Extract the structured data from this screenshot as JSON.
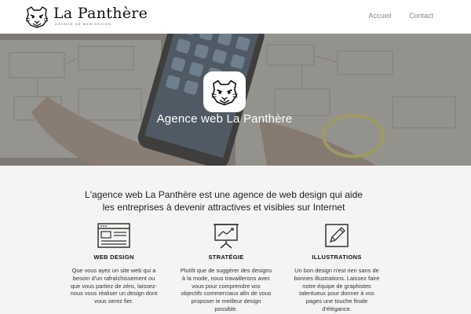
{
  "brand": {
    "name": "La Panthère",
    "tagline": "AGENCE DE WEB DESIGN",
    "logo_icon": "panther-head-icon"
  },
  "nav": {
    "items": [
      {
        "label": "Accueil"
      },
      {
        "label": "Contact"
      }
    ]
  },
  "hero": {
    "title": "Agence web La Panthère",
    "badge_icon": "panther-head-icon"
  },
  "intro": {
    "line1": "L'agence web La Panthère est une agence de web design qui aide",
    "line2": "les entreprises à devenir attractives et visibles sur Internet"
  },
  "features": [
    {
      "icon": "browser-window-icon",
      "title": "WEB DESIGN",
      "lines": [
        "Que vous ayez un site web qui a",
        "besoin d'un rafraîchissement ou",
        "que vous partiez de zéro, laissez-",
        "nous vous réaliser un design dont",
        "vous serez fier."
      ]
    },
    {
      "icon": "presentation-chart-icon",
      "title": "STRATÉGIE",
      "lines": [
        "Plutôt que de suggérer des designs",
        "à la mode, nous travaillerons avec",
        "vous pour comprendre vos",
        "objectifs commerciaux afin de vous",
        "proposer le meilleur design",
        "possible."
      ]
    },
    {
      "icon": "pencil-edit-icon",
      "title": "ILLUSTRATIONS",
      "lines": [
        "Un bon design n'est rien sans de",
        "bonnes illustrations. Laissez faire",
        "notre équipe de graphistes",
        "talentueux pour donner à vos",
        "pages une touche finale",
        "d'élégance."
      ]
    }
  ],
  "colors": {
    "header_bg": "#ffffff",
    "page_bg": "#f5f4f2",
    "hero_overlay": "#6d6a67",
    "text": "#222222",
    "nav_text": "#888888"
  }
}
